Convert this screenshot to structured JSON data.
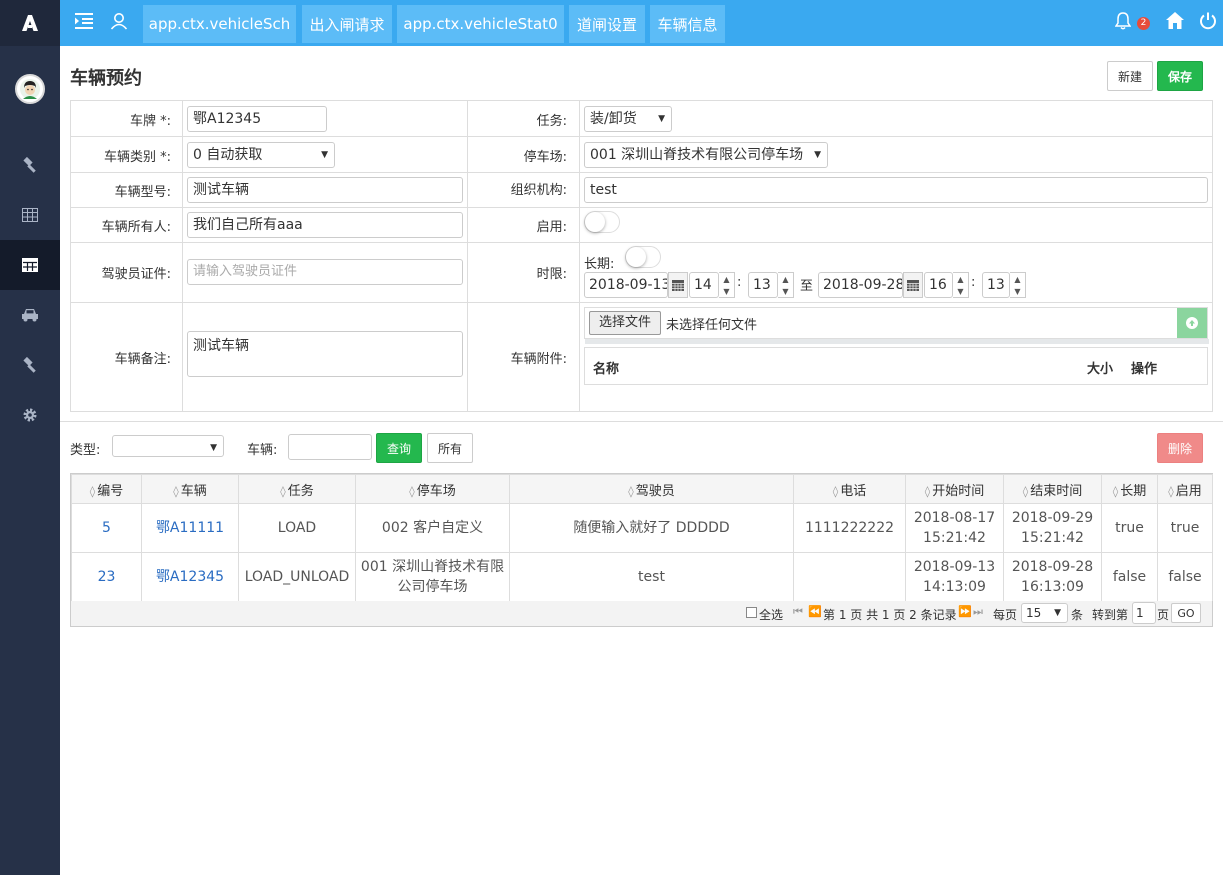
{
  "topbar": {
    "tabs": [
      "app.ctx.vehicleSch",
      "出入闸请求",
      "app.ctx.vehicleStat0",
      "道闸设置",
      "车辆信息"
    ],
    "notification_count": "2"
  },
  "page": {
    "title": "车辆预约",
    "new_label": "新建",
    "save_label": "保存"
  },
  "form": {
    "plate_label": "车牌 *:",
    "plate_value": "鄂A12345",
    "task_label": "任务:",
    "task_value": "装/卸货",
    "vtype_label": "车辆类别 *:",
    "vtype_value": "0 自动获取",
    "parking_label": "停车场:",
    "parking_value": "001 深圳山脊技术有限公司停车场",
    "model_label": "车辆型号:",
    "model_value": "测试车辆",
    "org_label": "组织机构:",
    "org_value": "test",
    "owner_label": "车辆所有人:",
    "owner_value": "我们自己所有aaa",
    "enable_label": "启用:",
    "license_label": "驾驶员证件:",
    "license_placeholder": "请输入驾驶员证件",
    "period_label": "时限:",
    "longterm_label": "长期:",
    "start_date": "2018-09-13",
    "start_hour": "14",
    "start_min": "13",
    "to_label": "至",
    "end_date": "2018-09-28",
    "end_hour": "16",
    "end_min": "13",
    "colon": ":",
    "remark_label": "车辆备注:",
    "remark_value": "测试车辆",
    "attach_label": "车辆附件:",
    "choose_file_label": "选择文件",
    "no_file_label": "未选择任何文件",
    "attach_col_name": "名称",
    "attach_col_size": "大小",
    "attach_col_ops": "操作"
  },
  "filter": {
    "type_label": "类型:",
    "vehicle_label": "车辆:",
    "query_label": "查询",
    "all_label": "所有",
    "delete_label": "删除"
  },
  "table": {
    "columns": [
      "编号",
      "车辆",
      "任务",
      "停车场",
      "驾驶员",
      "电话",
      "开始时间",
      "结束时间",
      "长期",
      "启用"
    ],
    "rows": [
      {
        "id": "5",
        "vehicle": "鄂A11111",
        "task": "LOAD",
        "parking": "002 客户自定义",
        "driver": "随便输入就好了 DDDDD",
        "phone": "1111222222",
        "start_d": "2018-08-17",
        "start_t": "15:21:42",
        "end_d": "2018-09-29",
        "end_t": "15:21:42",
        "longterm": "true",
        "enabled": "true"
      },
      {
        "id": "23",
        "vehicle": "鄂A12345",
        "task": "LOAD_UNLOAD",
        "parking": "001 深圳山脊技术有限公司停车场",
        "driver": "test",
        "phone": "",
        "start_d": "2018-09-13",
        "start_t": "14:13:09",
        "end_d": "2018-09-28",
        "end_t": "16:13:09",
        "longterm": "false",
        "enabled": "false"
      }
    ]
  },
  "pager": {
    "select_all": "全选",
    "info": "第 1 页 共 1 页 2 条记录",
    "per_page": "每页",
    "per_page_value": "15",
    "unit": "条",
    "goto": "转到第",
    "page_value": "1",
    "page_unit": "页",
    "go": "GO"
  },
  "colors": {
    "topbar": "#3aa9f0",
    "sidebar": "#263148",
    "success": "#24b84e",
    "danger": "#f08a89",
    "link": "#2a6cc2"
  }
}
